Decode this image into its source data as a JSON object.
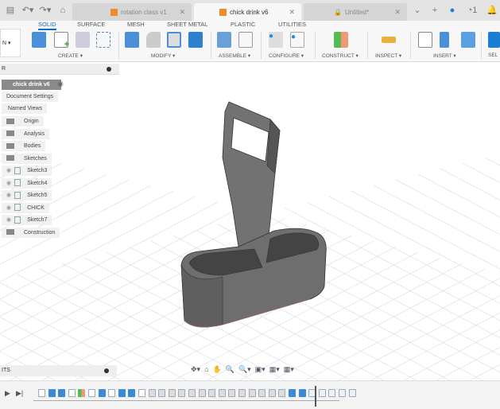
{
  "tabs": [
    {
      "label": "rotation class v1"
    },
    {
      "label": "chick drink v6"
    },
    {
      "label": "Untitled*"
    }
  ],
  "header_extra": {
    "jobs": "1"
  },
  "ribbon": {
    "tabs": [
      "SOLID",
      "SURFACE",
      "MESH",
      "SHEET METAL",
      "PLASTIC",
      "UTILITIES"
    ],
    "groups": [
      "CREATE ▾",
      "MODIFY ▾",
      "ASSEMBLE ▾",
      "CONFIGURE ▾",
      "CONSTRUCT ▾",
      "INSPECT ▾",
      "INSERT ▾",
      "SEL"
    ],
    "workspace": "N ▾"
  },
  "browser": {
    "title": "R",
    "root": "chick drink v6",
    "items": [
      "Document Settings",
      "Named Views",
      "Origin",
      "Analysis",
      "Bodies",
      "Sketches",
      "Sketch3",
      "Sketch4",
      "Sketch5",
      "CHICK",
      "Sketch7",
      "Construction"
    ]
  },
  "comments": {
    "title": "ITS"
  },
  "navbar": [
    "✥▾",
    "⌂",
    "✋",
    "🔍",
    "🔍▾",
    "▣▾",
    "▦▾",
    "▦▾"
  ],
  "timeline": {
    "controls": [
      "▶",
      "▶|"
    ],
    "features": [
      "s",
      "b",
      "b",
      "s",
      "c",
      "s",
      "b",
      "s",
      "b",
      "b",
      "s",
      "f",
      "f",
      "f",
      "f",
      "f",
      "f",
      "f",
      "f",
      "f",
      "f",
      "f",
      "f",
      "f",
      "f",
      "b",
      "b",
      "g",
      "g",
      "g",
      "g",
      "g"
    ],
    "marker_index": 27
  },
  "colors": {
    "accent": "#0a6fc2",
    "model": "#6b6b6b",
    "grid": "#d5dbe3"
  }
}
